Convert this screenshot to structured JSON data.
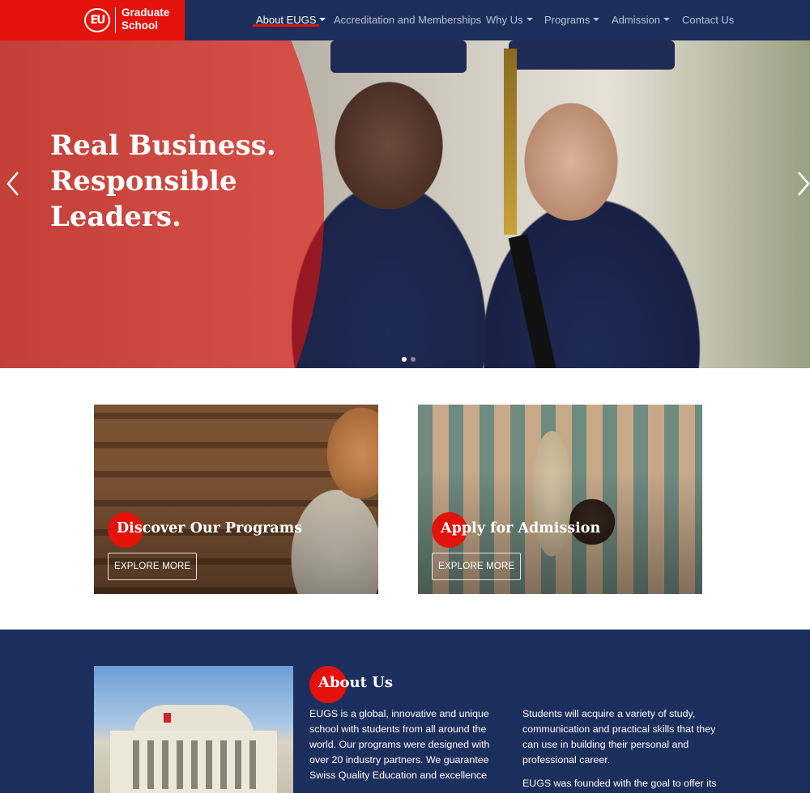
{
  "brand": {
    "logo_mark": "EU",
    "line1": "Graduate",
    "line2": "School",
    "accent_color": "#e3120b",
    "navy_color": "#1c2f5c"
  },
  "nav": {
    "items": [
      {
        "label": "About EUGS",
        "dropdown": true,
        "active": true
      },
      {
        "label": "Accreditation and Memberships",
        "dropdown": false,
        "active": false
      },
      {
        "label": "Why Us",
        "dropdown": true,
        "active": false
      },
      {
        "label": "Programs",
        "dropdown": true,
        "active": false
      },
      {
        "label": "Admission",
        "dropdown": true,
        "active": false
      },
      {
        "label": "Contact Us",
        "dropdown": false,
        "active": false
      }
    ]
  },
  "hero": {
    "line1": "Real Business.",
    "line2": "Responsible",
    "line3": "Leaders.",
    "prev_icon": "chevron-left-icon",
    "next_icon": "chevron-right-icon",
    "slides_total": 2,
    "active_slide": 1
  },
  "cards": [
    {
      "title": "Discover Our Programs",
      "button": "EXPLORE MORE"
    },
    {
      "title": "Apply for Admission",
      "button": "EXPLORE MORE"
    }
  ],
  "about": {
    "title": "About Us",
    "col1": "EUGS is a global, innovative and unique school with students from all around the world. Our programs were designed with over 20 industry partners. We guarantee Swiss Quality Education and excellence",
    "col2_p1": "Students will acquire a variety of study, communication and practical skills that they can use in building their personal and professional career.",
    "col2_p2": "EUGS was founded with the goal to offer its"
  }
}
